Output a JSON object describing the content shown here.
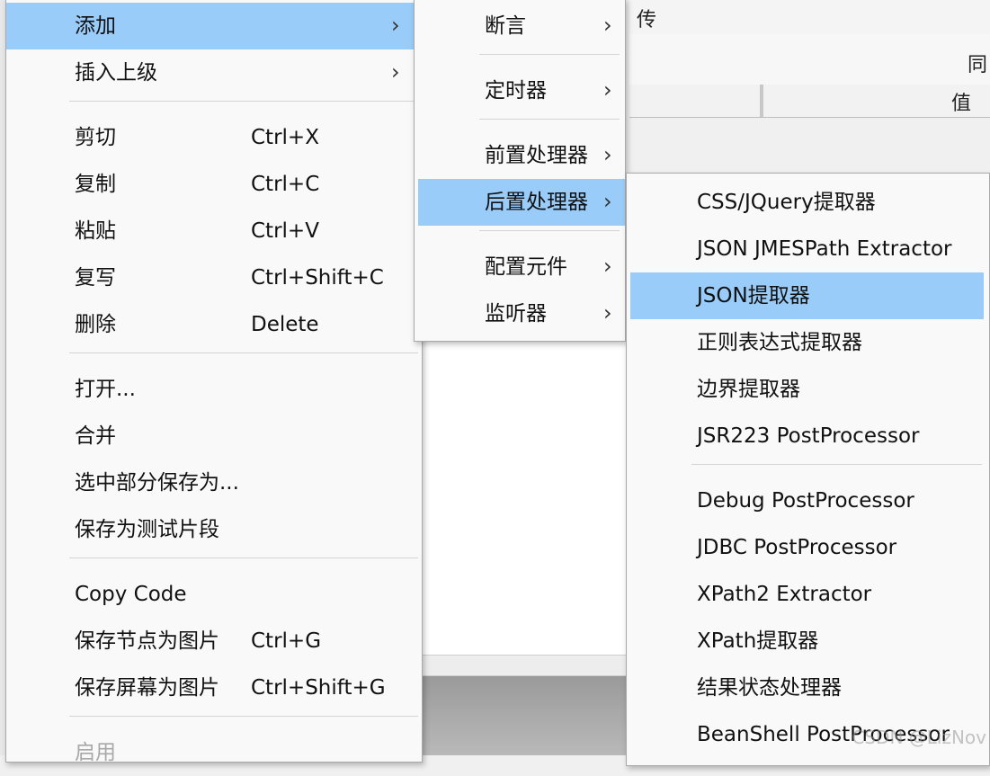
{
  "background": {
    "top_fragment": "传",
    "row2_fragment": "同",
    "column_header_value": "值"
  },
  "context_menu": {
    "items": [
      {
        "label": "添加",
        "has_submenu": true,
        "highlighted": true
      },
      {
        "label": "插入上级",
        "has_submenu": true
      },
      {
        "label": "剪切",
        "shortcut": "Ctrl+X"
      },
      {
        "label": "复制",
        "shortcut": "Ctrl+C"
      },
      {
        "label": "粘贴",
        "shortcut": "Ctrl+V"
      },
      {
        "label": "复写",
        "shortcut": "Ctrl+Shift+C"
      },
      {
        "label": "删除",
        "shortcut": "Delete"
      },
      {
        "label": "打开..."
      },
      {
        "label": "合并"
      },
      {
        "label": "选中部分保存为..."
      },
      {
        "label": "保存为测试片段"
      },
      {
        "label": "Copy Code"
      },
      {
        "label": "保存节点为图片",
        "shortcut": "Ctrl+G"
      },
      {
        "label": "保存屏幕为图片",
        "shortcut": "Ctrl+Shift+G"
      },
      {
        "label": "启用",
        "disabled": true
      }
    ]
  },
  "add_submenu": {
    "items": [
      {
        "label": "断言",
        "has_submenu": true
      },
      {
        "label": "定时器",
        "has_submenu": true
      },
      {
        "label": "前置处理器",
        "has_submenu": true
      },
      {
        "label": "后置处理器",
        "has_submenu": true,
        "highlighted": true
      },
      {
        "label": "配置元件",
        "has_submenu": true
      },
      {
        "label": "监听器",
        "has_submenu": true
      }
    ]
  },
  "postprocessor_submenu": {
    "items": [
      {
        "label": "CSS/JQuery提取器"
      },
      {
        "label": "JSON JMESPath Extractor"
      },
      {
        "label": "JSON提取器",
        "highlighted": true
      },
      {
        "label": "正则表达式提取器"
      },
      {
        "label": "边界提取器"
      },
      {
        "label": "JSR223 PostProcessor"
      },
      {
        "label": "Debug PostProcessor"
      },
      {
        "label": "JDBC PostProcessor"
      },
      {
        "label": "XPath2 Extractor"
      },
      {
        "label": "XPath提取器"
      },
      {
        "label": "结果状态处理器"
      },
      {
        "label": "BeanShell PostProcessor"
      }
    ]
  },
  "submenu_arrow_glyph": "›",
  "watermark": "CSDN @LizNov",
  "colors": {
    "highlight": "#99ccf9",
    "menu_background": "#f9f9f9",
    "separator": "#d4d4d4",
    "disabled_text": "#a8a8a8"
  }
}
